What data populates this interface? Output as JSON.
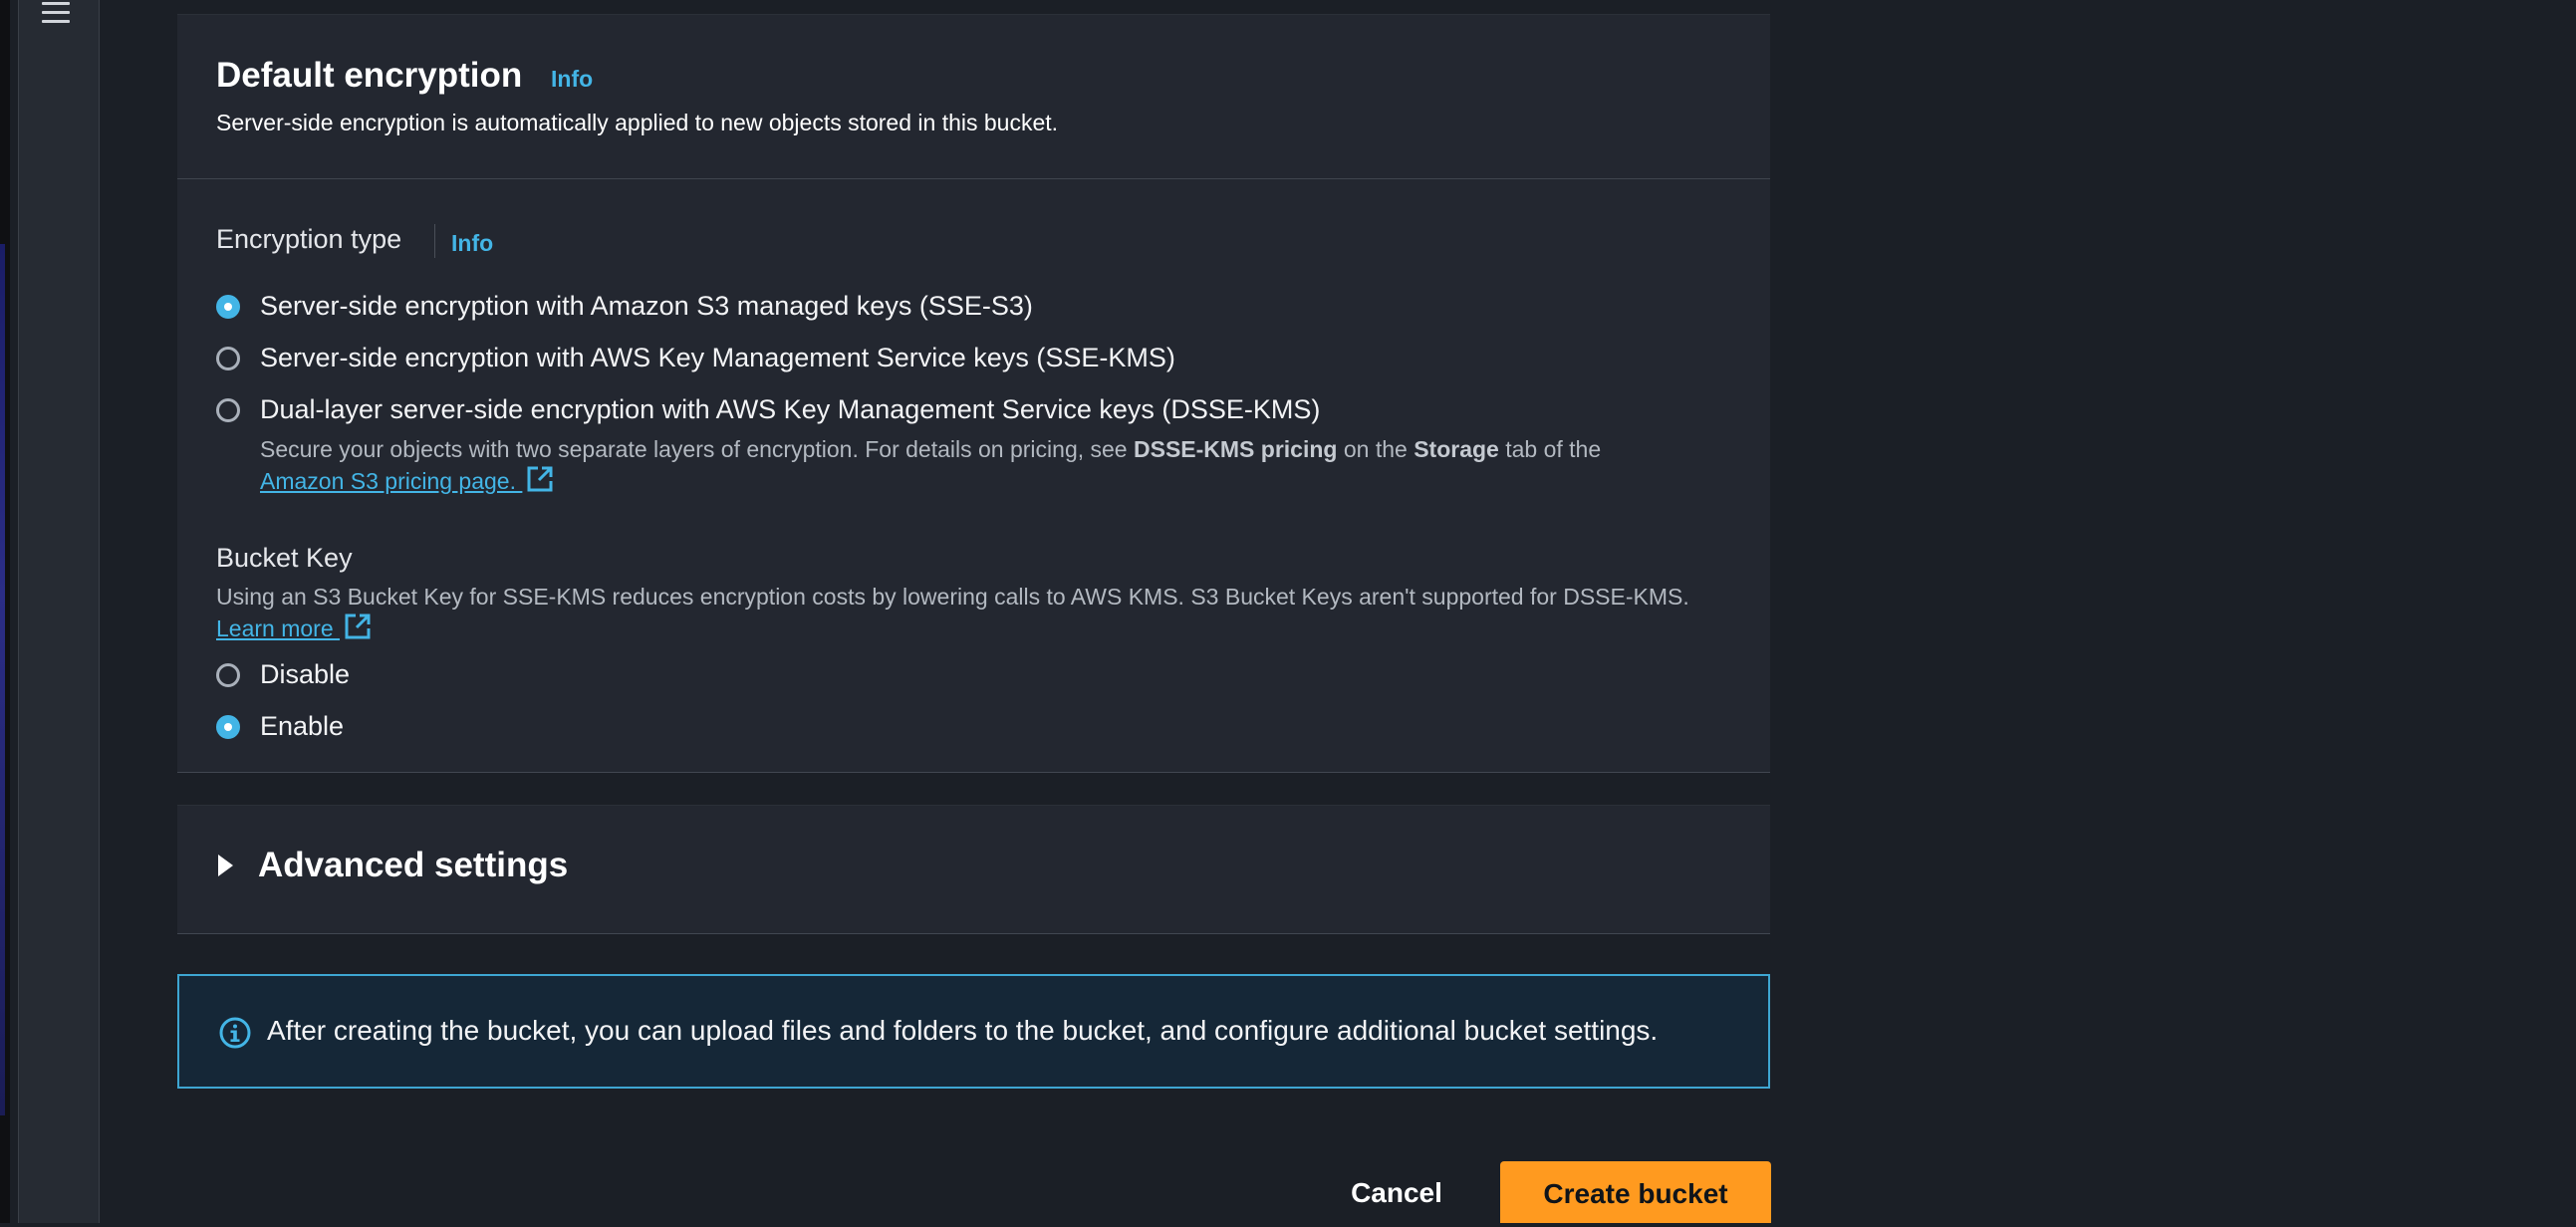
{
  "nav": {
    "menu_icon": "hamburger-menu-icon"
  },
  "default_encryption": {
    "title": "Default encryption",
    "info_label": "Info",
    "description": "Server-side encryption is automatically applied to new objects stored in this bucket.",
    "encryption_type": {
      "label": "Encryption type",
      "info_label": "Info",
      "options": [
        {
          "label": "Server-side encryption with Amazon S3 managed keys (SSE-S3)",
          "selected": true
        },
        {
          "label": "Server-side encryption with AWS Key Management Service keys (SSE-KMS)",
          "selected": false
        },
        {
          "label": "Dual-layer server-side encryption with AWS Key Management Service keys (DSSE-KMS)",
          "selected": false
        }
      ],
      "dsse_help": {
        "text_before": "Secure your objects with two separate layers of encryption. For details on pricing, see ",
        "bold_1": "DSSE-KMS pricing",
        "text_middle": " on the ",
        "bold_2": "Storage",
        "text_after": " tab of the ",
        "link": "Amazon S3 pricing page. "
      }
    },
    "bucket_key": {
      "label": "Bucket Key",
      "description": "Using an S3 Bucket Key for SSE-KMS reduces encryption costs by lowering calls to AWS KMS. S3 Bucket Keys aren't supported for DSSE-KMS. ",
      "learn_more": "Learn more ",
      "options": [
        {
          "label": "Disable",
          "selected": false
        },
        {
          "label": "Enable",
          "selected": true
        }
      ]
    }
  },
  "advanced_settings": {
    "title": "Advanced settings",
    "expanded": false
  },
  "alert": {
    "icon": "info-circle-icon",
    "text": "After creating the bucket, you can upload files and folders to the bucket, and configure additional bucket settings."
  },
  "actions": {
    "cancel": "Cancel",
    "create": "Create bucket"
  },
  "colors": {
    "accent": "#43b5e6",
    "primary_button": "#ff9a1f",
    "panel": "#232730",
    "background": "#1b1f26",
    "alert_border": "#3ea6d2"
  }
}
